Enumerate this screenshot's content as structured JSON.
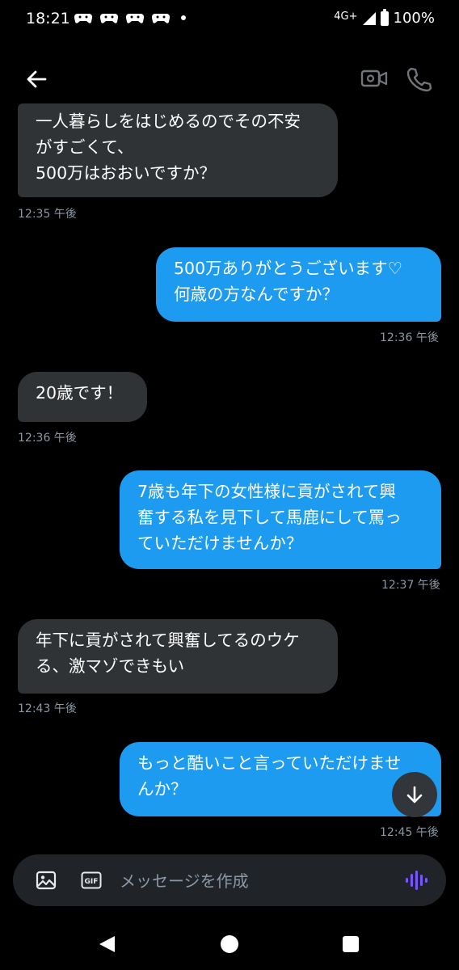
{
  "status_bar": {
    "time": "18:21",
    "network": "4G+",
    "battery": "100%",
    "left_icons": [
      "game-controller-icon",
      "game-controller-icon",
      "game-controller-icon",
      "game-controller-icon",
      "notification-dot-icon"
    ],
    "right_icons": [
      "signal-icon",
      "battery-icon"
    ]
  },
  "header": {
    "icons": [
      "back-arrow-icon",
      "video-call-icon",
      "phone-call-icon"
    ]
  },
  "messages": [
    {
      "side": "received",
      "text": "一人暮らしをはじめるのでその不安\nがすごくて、\n500万はおおいですか？",
      "time": "12:35 午後"
    },
    {
      "side": "sent",
      "text": "500万ありがとうございます♡\n何歳の方なんですか？",
      "time": "12:36 午後"
    },
    {
      "side": "received",
      "text": "20歳です！",
      "time": "12:36 午後"
    },
    {
      "side": "sent",
      "text": "7歳も年下の女性様に貢がされて興\n奮する私を見下して馬鹿にして罵っ\nていただけませんか？",
      "time": "12:37 午後"
    },
    {
      "side": "received",
      "text": "年下に貢がされて興奮してるのウケ\nる、激マゾできもい",
      "time": "12:43 午後"
    },
    {
      "side": "sent",
      "text": "もっと酷いこと言っていただけませ\nんか？",
      "time": "12:45 午後"
    }
  ],
  "composer": {
    "placeholder": "メッセージを作成",
    "gif_label": "GIF"
  },
  "colors": {
    "sent_bubble": "#1d9bf0",
    "received_bubble": "#2f3336",
    "voice_accent": "#7856ff"
  }
}
